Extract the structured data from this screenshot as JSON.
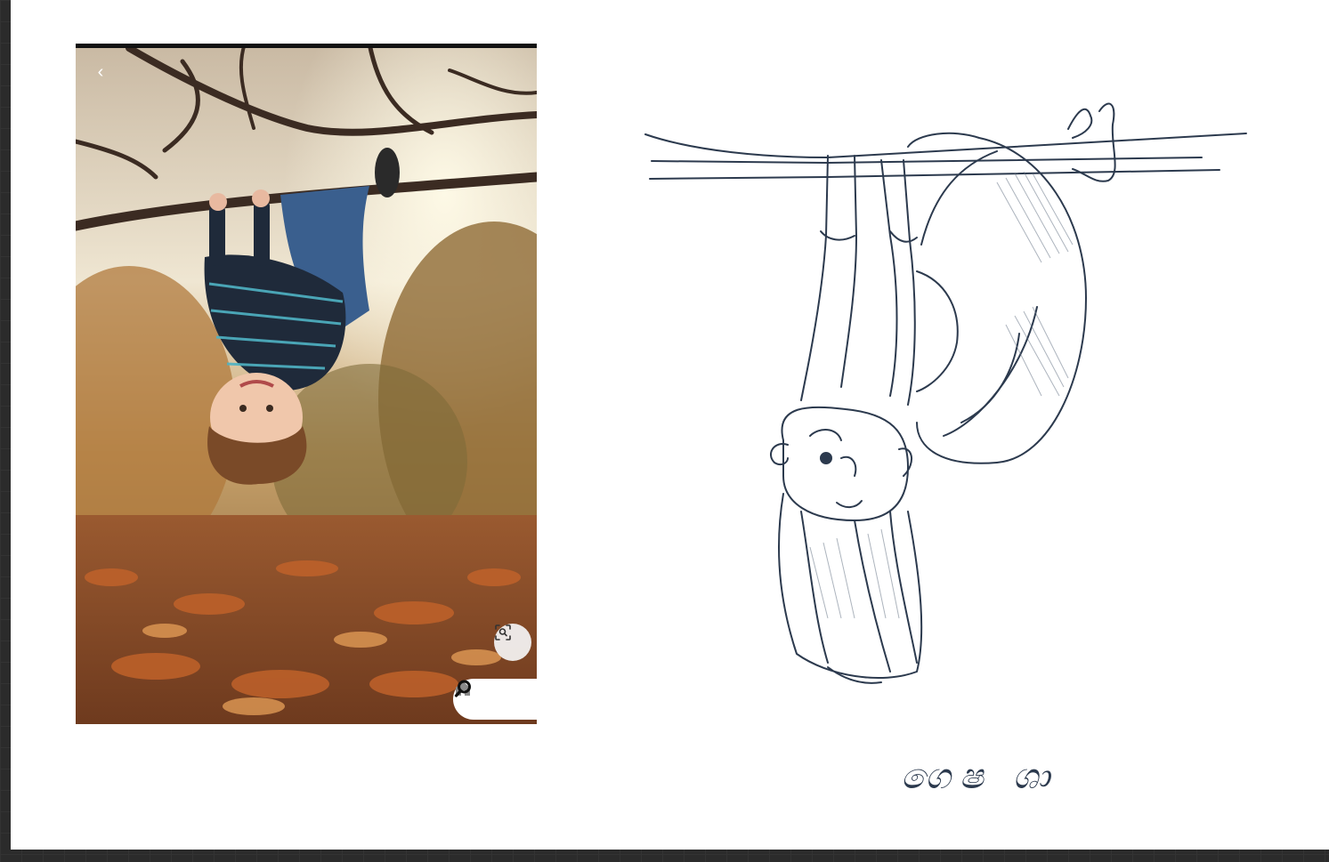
{
  "canvas": {
    "background": "#ffffff",
    "workspace_background": "#2b2b2b"
  },
  "photo_viewer": {
    "back_icon": "chevron-left-icon",
    "lens_icon": "visual-search-icon",
    "nav": {
      "home_icon": "home-icon",
      "search_icon": "search-icon"
    }
  },
  "sketch": {
    "ink_color": "#2c3a4e",
    "caption": "ගෙෂ ශා"
  }
}
